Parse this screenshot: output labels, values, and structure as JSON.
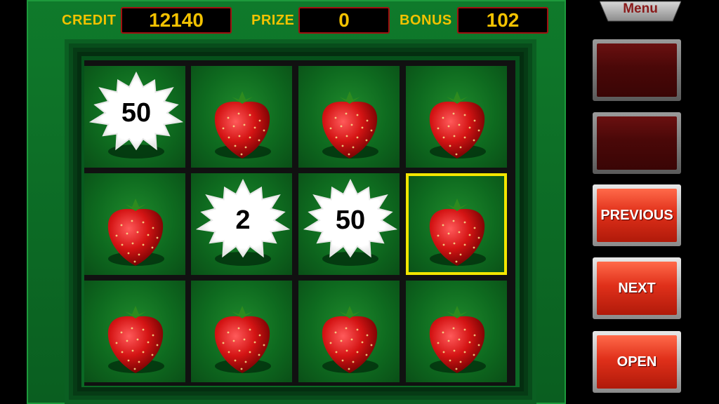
{
  "hud": {
    "credit_label": "CREDIT",
    "credit_value": "12140",
    "prize_label": "PRIZE",
    "prize_value": "0",
    "bonus_label": "BONUS",
    "bonus_value": "102"
  },
  "grid": {
    "rows": [
      [
        {
          "type": "burst",
          "value": "50"
        },
        {
          "type": "strawberry"
        },
        {
          "type": "strawberry"
        },
        {
          "type": "strawberry"
        }
      ],
      [
        {
          "type": "strawberry"
        },
        {
          "type": "burst",
          "value": "2"
        },
        {
          "type": "burst",
          "value": "50"
        },
        {
          "type": "strawberry",
          "selected": true
        }
      ],
      [
        {
          "type": "strawberry"
        },
        {
          "type": "strawberry"
        },
        {
          "type": "strawberry"
        },
        {
          "type": "strawberry"
        }
      ]
    ]
  },
  "panel": {
    "menu_label": "Menu",
    "buttons": [
      {
        "label": "",
        "enabled": false
      },
      {
        "label": "",
        "enabled": false
      },
      {
        "label": "PREVIOUS",
        "enabled": true
      },
      {
        "label": "NEXT",
        "enabled": true
      },
      {
        "label": "OPEN",
        "enabled": true
      }
    ]
  },
  "colors": {
    "hud_text": "#f2c200",
    "selection": "#f3e600",
    "board_green": "#0f7a2b",
    "button_red": "#e0301a"
  },
  "icons": {
    "cell_symbol": "strawberry-icon",
    "reveal_symbol": "burst-icon"
  }
}
